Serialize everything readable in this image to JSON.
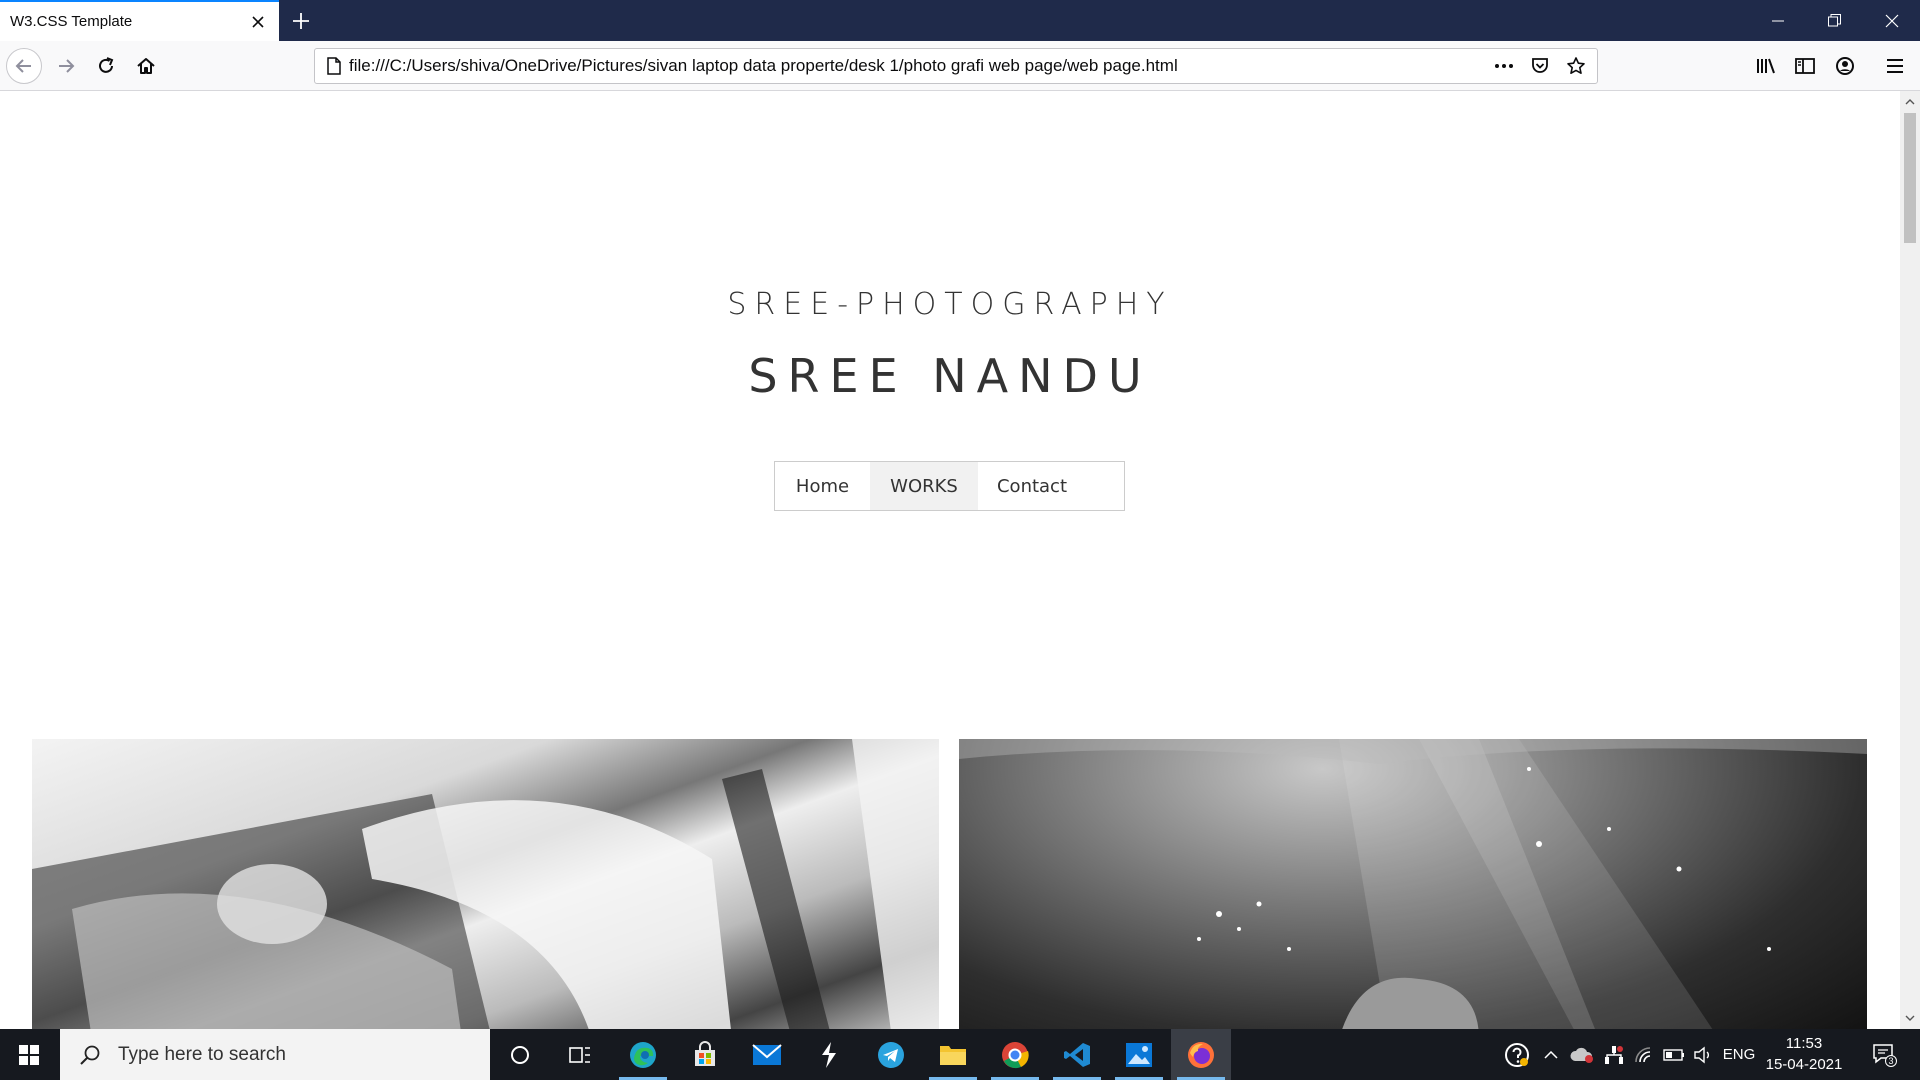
{
  "browser": {
    "tab_title": "W3.CSS Template",
    "url": "file:///C:/Users/shiva/OneDrive/Pictures/sivan laptop data properte/desk 1/photo grafi web page/web page.html"
  },
  "page": {
    "brand_subtitle": "SREE-PHOTOGRAPHY",
    "brand_title": "SREE NANDU",
    "menu": {
      "home": "Home",
      "works": "WORKS",
      "contact": "Contact"
    }
  },
  "taskbar": {
    "search_placeholder": "Type here to search",
    "language": "ENG",
    "time": "11:53",
    "date": "15-04-2021",
    "notification_count": "3"
  },
  "icons": {
    "tab": [
      "close-icon",
      "plus-icon"
    ],
    "window": [
      "minimize-icon",
      "restore-icon",
      "close-icon"
    ],
    "nav": [
      "back-arrow-icon",
      "forward-arrow-icon",
      "reload-icon",
      "home-icon"
    ],
    "url": [
      "page-icon",
      "more-dots-icon",
      "pocket-icon",
      "bookmark-star-icon"
    ],
    "toolbar": [
      "library-icon",
      "sidebar-icon",
      "account-icon",
      "menu-icon"
    ],
    "taskbar_apps": [
      "cortana-icon",
      "task-view-icon",
      "edge-icon",
      "store-icon",
      "mail-icon",
      "app-icon",
      "telegram-icon",
      "file-explorer-icon",
      "chrome-icon",
      "vscode-icon",
      "photos-icon",
      "firefox-icon"
    ],
    "tray": [
      "help-icon",
      "chevron-up-icon",
      "cloud-icon",
      "network-icon",
      "wifi-icon",
      "battery-icon",
      "volume-icon",
      "notification-icon"
    ]
  },
  "colors": {
    "tabstrip": "#1f2a4a",
    "active_tab_accent": "#0a84ff",
    "taskbar": "#16191f",
    "menu_active_bg": "#f1f1f1",
    "text": "#333333"
  }
}
